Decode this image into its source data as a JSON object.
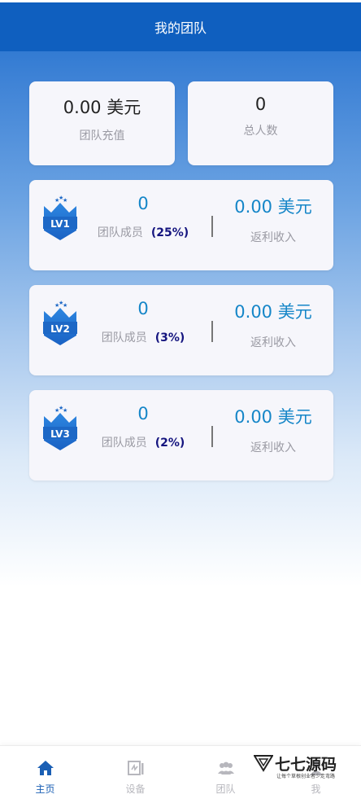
{
  "header": {
    "title": "我的团队"
  },
  "stats": [
    {
      "value": "0.00 美元",
      "label": "团队充值"
    },
    {
      "value": "0",
      "label": "总人数"
    }
  ],
  "levels": [
    {
      "badge": "LV1",
      "members": "0",
      "members_label": "团队成员",
      "percent": "(25%)",
      "income": "0.00 美元",
      "income_label": "返利收入"
    },
    {
      "badge": "LV2",
      "members": "0",
      "members_label": "团队成员",
      "percent": "(3%)",
      "income": "0.00 美元",
      "income_label": "返利收入"
    },
    {
      "badge": "LV3",
      "members": "0",
      "members_label": "团队成员",
      "percent": "(2%)",
      "income": "0.00 美元",
      "income_label": "返利收入"
    }
  ],
  "nav": [
    {
      "label": "主页",
      "icon": "home-icon",
      "active": true
    },
    {
      "label": "设备",
      "icon": "device-icon",
      "active": false
    },
    {
      "label": "团队",
      "icon": "team-icon",
      "active": false
    },
    {
      "label": "我",
      "icon": "user-icon",
      "active": false
    }
  ],
  "watermark": {
    "title": "七七源码",
    "subtitle": "让每个草根创业者少走弯路"
  },
  "colors": {
    "header": "#0f5fbf",
    "accent": "#1586c8",
    "percent": "#15157f",
    "nav_active": "#1a5fb4"
  }
}
